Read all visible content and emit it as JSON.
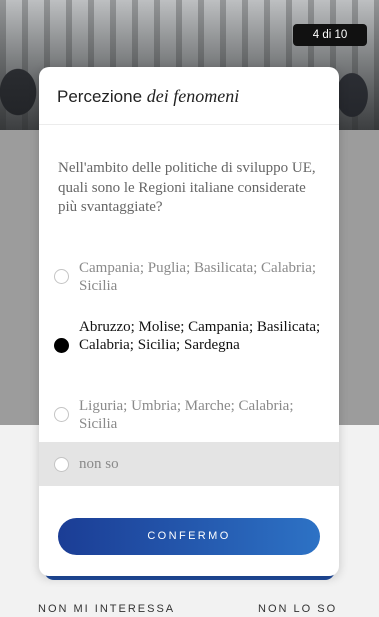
{
  "counter": "4 di 10",
  "modal": {
    "title_plain": "Percezione",
    "title_italic": "dei fenomeni",
    "question": "Nell'ambito delle politiche di sviluppo UE, quali sono le Regioni italiane considerate più svantaggiate?",
    "options": [
      {
        "label": "Campania; Puglia; Basilicata; Calabria; Sicilia",
        "selected": false
      },
      {
        "label": "Abruzzo; Molise; Campania; Basilicata; Calabria; Sicilia; Sardegna",
        "selected": true
      },
      {
        "label": "Liguria; Umbria; Marche; Calabria; Sicilia",
        "selected": false
      },
      {
        "label": "non so",
        "selected": false
      }
    ],
    "confirm_label": "CONFERMO"
  },
  "footer": {
    "left_label": "NON MI INTERESSA",
    "right_label": "NON LO SO"
  }
}
